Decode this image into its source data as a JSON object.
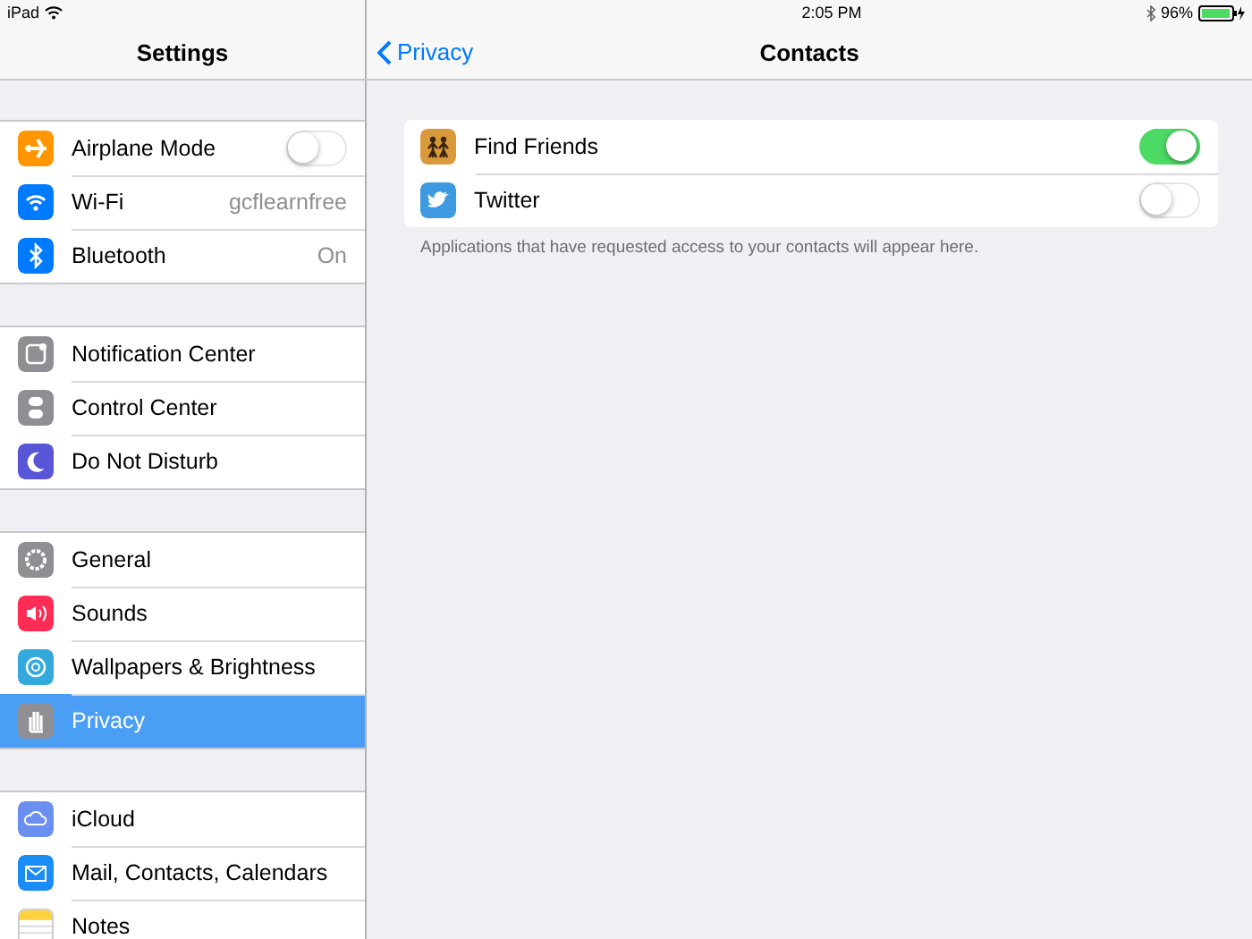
{
  "status_bar": {
    "device": "iPad",
    "time": "2:05 PM",
    "battery": "96%"
  },
  "sidebar": {
    "title": "Settings",
    "groups": [
      {
        "items": [
          {
            "label": "Airplane Mode",
            "kind": "toggle",
            "on": false,
            "selected": false
          },
          {
            "label": "Wi-Fi",
            "kind": "detail",
            "value": "gcflearnfree",
            "selected": false
          },
          {
            "label": "Bluetooth",
            "kind": "detail",
            "value": "On",
            "selected": false
          }
        ]
      },
      {
        "items": [
          {
            "label": "Notification Center",
            "kind": "link",
            "selected": false
          },
          {
            "label": "Control Center",
            "kind": "link",
            "selected": false
          },
          {
            "label": "Do Not Disturb",
            "kind": "link",
            "selected": false
          }
        ]
      },
      {
        "items": [
          {
            "label": "General",
            "kind": "link",
            "selected": false
          },
          {
            "label": "Sounds",
            "kind": "link",
            "selected": false
          },
          {
            "label": "Wallpapers & Brightness",
            "kind": "link",
            "selected": false
          },
          {
            "label": "Privacy",
            "kind": "link",
            "selected": true
          }
        ]
      },
      {
        "items": [
          {
            "label": "iCloud",
            "kind": "link",
            "selected": false
          },
          {
            "label": "Mail, Contacts, Calendars",
            "kind": "link",
            "selected": false
          },
          {
            "label": "Notes",
            "kind": "link",
            "selected": false
          }
        ]
      }
    ]
  },
  "detail": {
    "back": "Privacy",
    "title": "Contacts",
    "apps": [
      {
        "label": "Find Friends",
        "on": true
      },
      {
        "label": "Twitter",
        "on": false
      }
    ],
    "footer": "Applications that have requested access to your contacts will appear here."
  }
}
